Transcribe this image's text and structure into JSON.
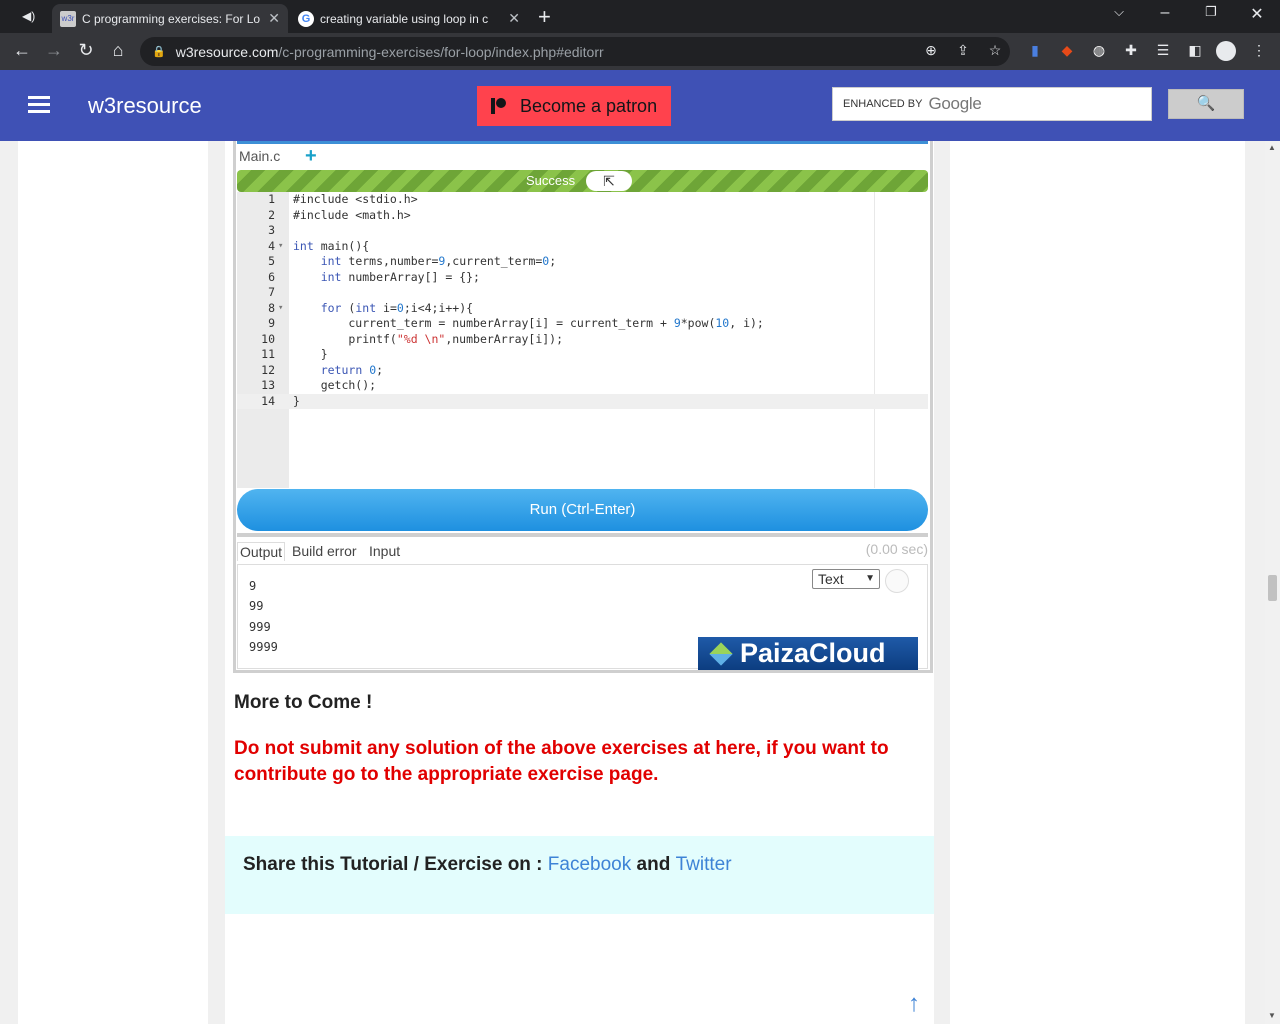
{
  "browser": {
    "tabs": [
      {
        "title": "C programming exercises: For Lo",
        "active": true,
        "favicon": "w3r"
      },
      {
        "title": "creating variable using loop in c",
        "active": false,
        "favicon": "google-icon"
      }
    ],
    "new_tab": "+",
    "url_host": "w3resource.com",
    "url_path": "/c-programming-exercises/for-loop/index.php#editorr"
  },
  "header": {
    "site_name": "w3resource",
    "patron_label": "Become a patron",
    "search_enhanced": "ENHANCED BY",
    "search_google": "Google",
    "search_button": "🔍"
  },
  "editor": {
    "file_tab": "Main.c",
    "add_file": "+",
    "status": "Success",
    "lines": [
      {
        "n": "1",
        "fold": "",
        "text": "#include <stdio.h>"
      },
      {
        "n": "2",
        "fold": "",
        "text": "#include <math.h>"
      },
      {
        "n": "3",
        "fold": "",
        "text": ""
      },
      {
        "n": "4",
        "fold": "▾",
        "text": "int main(){"
      },
      {
        "n": "5",
        "fold": "",
        "text": "    int terms,number=9,current_term=0;"
      },
      {
        "n": "6",
        "fold": "",
        "text": "    int numberArray[] = {};"
      },
      {
        "n": "7",
        "fold": "",
        "text": ""
      },
      {
        "n": "8",
        "fold": "▾",
        "text": "    for (int i=0;i<4;i++){"
      },
      {
        "n": "9",
        "fold": "",
        "text": "        current_term = numberArray[i] = current_term + 9*pow(10, i);"
      },
      {
        "n": "10",
        "fold": "",
        "text": "        printf(\"%d \\n\",numberArray[i]);"
      },
      {
        "n": "11",
        "fold": "",
        "text": "    }"
      },
      {
        "n": "12",
        "fold": "",
        "text": "    return 0;"
      },
      {
        "n": "13",
        "fold": "",
        "text": "    getch();"
      },
      {
        "n": "14",
        "fold": "",
        "text": "}"
      }
    ],
    "run_label": "Run (Ctrl-Enter)"
  },
  "output": {
    "tabs": [
      "Output",
      "Build error",
      "Input"
    ],
    "time": "(0.00 sec)",
    "format": "Text",
    "lines": [
      "9",
      "99",
      "999",
      "9999"
    ],
    "brand": "PaizaCloud"
  },
  "content": {
    "more_to_come": "More to Come !",
    "warning": "Do not submit any solution of the above exercises at here, if you want to contribute go to the appropriate exercise page.",
    "share_prefix": "Share this Tutorial / Exercise on :",
    "share_facebook": "Facebook",
    "share_and": "and",
    "share_twitter": "Twitter"
  },
  "colors": {
    "header_bg": "#3f51b5",
    "patron_bg": "#ff424d",
    "success": "#8bc34a",
    "run_button": "#2196f3",
    "warning_text": "#e10000",
    "link": "#3e83d6"
  }
}
